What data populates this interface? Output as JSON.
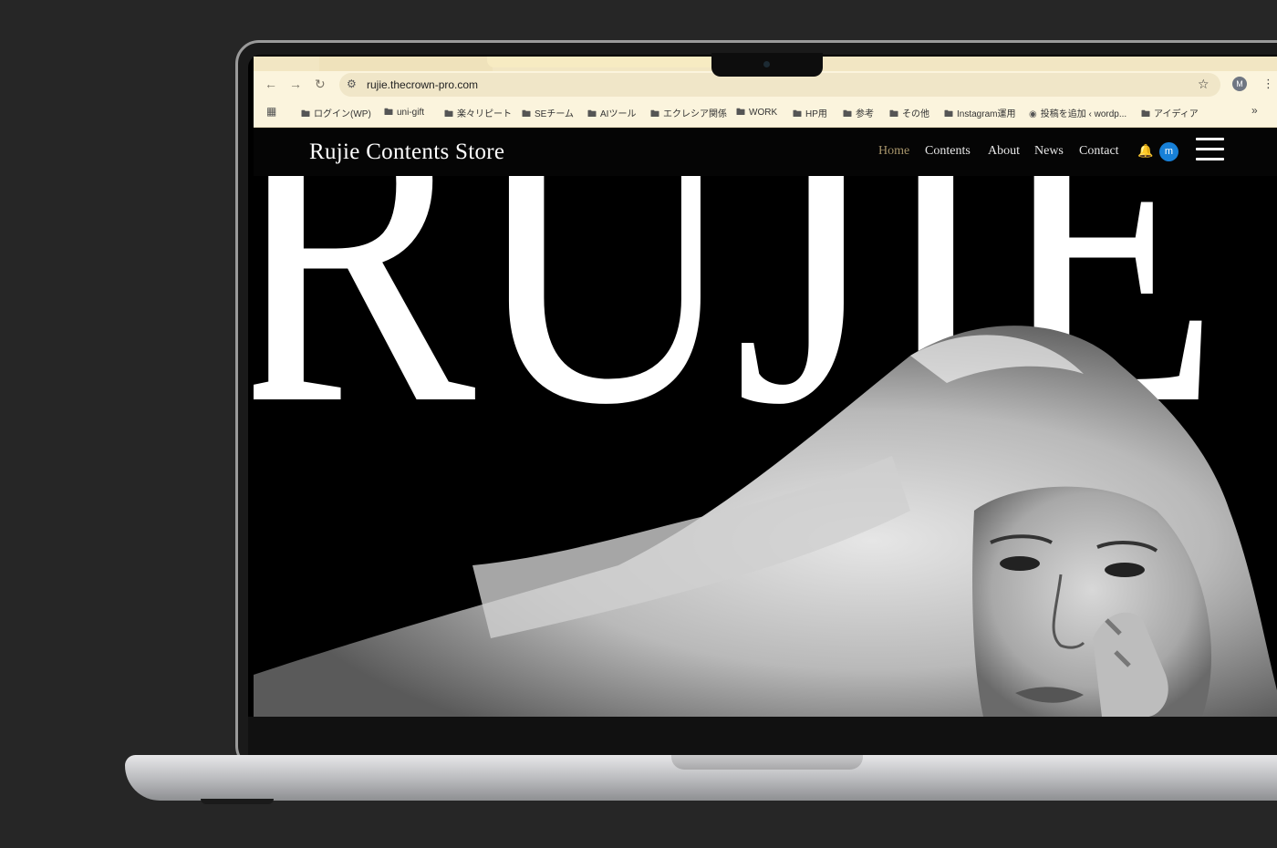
{
  "browser": {
    "url": "rujie.thecrown-pro.com",
    "profile_initial": "M",
    "bookmarks": [
      {
        "label": "ログイン(WP)"
      },
      {
        "label": "uni-gift"
      },
      {
        "label": "楽々リピート"
      },
      {
        "label": "SEチーム"
      },
      {
        "label": "AIツール"
      },
      {
        "label": "エクレシア関係"
      },
      {
        "label": "WORK"
      },
      {
        "label": "HP用"
      },
      {
        "label": "参考"
      },
      {
        "label": "その他"
      },
      {
        "label": "Instagram運用"
      },
      {
        "label": "投稿を追加 ‹ wordp..."
      },
      {
        "label": "アイディア"
      }
    ]
  },
  "site": {
    "logo": "Rujie Contents Store",
    "nav": [
      "Home",
      "Contents",
      "About",
      "News",
      "Contact"
    ],
    "active_nav": "Home",
    "avatar_initial": "m",
    "hero_word": "RUJIE"
  },
  "colors": {
    "background": "#262626",
    "nav_active": "#a6946a",
    "avatar": "#1780d8",
    "chrome": "#fbf4dd"
  },
  "icons": [
    "back-icon",
    "forward-icon",
    "reload-icon",
    "site-settings-icon",
    "star-icon",
    "kebab-icon",
    "apps-icon",
    "folder-icon",
    "chevron-double-right-icon",
    "bell-icon",
    "hamburger-icon"
  ]
}
